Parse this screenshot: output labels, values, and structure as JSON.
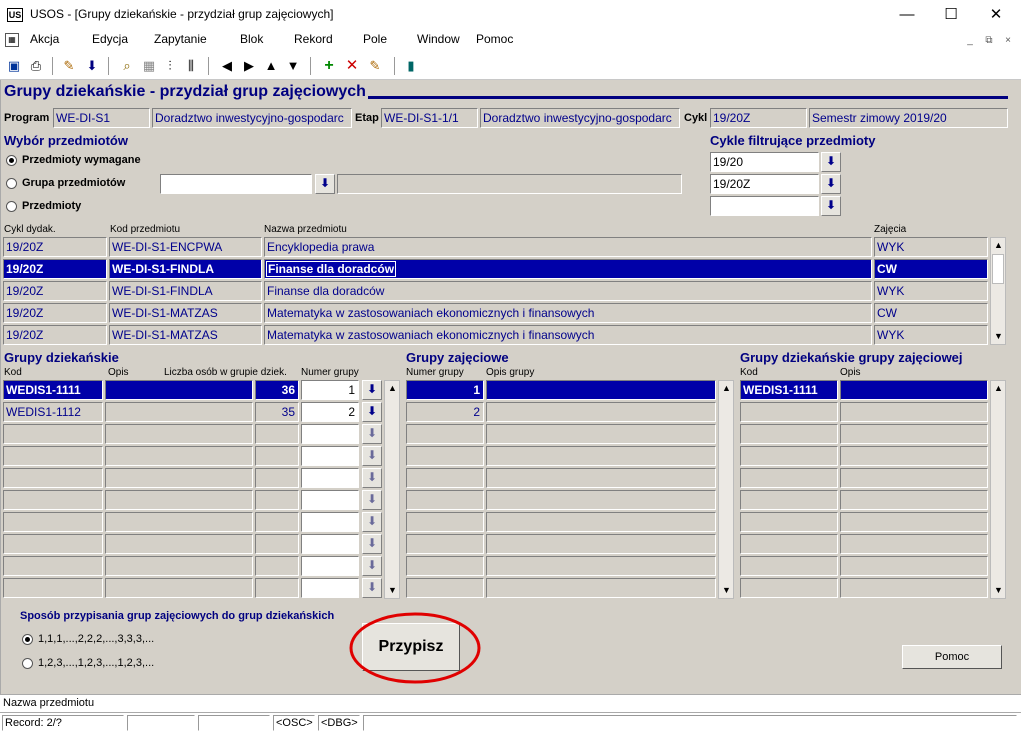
{
  "window": {
    "title": "USOS - [Grupy dziekańskie - przydział grup zajęciowych]",
    "minimize": "—",
    "maximize": "☐",
    "close": "✕"
  },
  "menu": {
    "items": [
      "Akcja",
      "Edycja",
      "Zapytanie",
      "Blok",
      "Rekord",
      "Pole",
      "Window",
      "Pomoc"
    ],
    "mdi_minimize": "_",
    "mdi_restore": "⧉",
    "mdi_close": "×"
  },
  "toolbar": {
    "icons": [
      "save-icon",
      "print-icon",
      "edit-icon",
      "download-icon",
      "query-icon",
      "grid-icon",
      "chart-icon",
      "chart2-icon",
      "first-icon",
      "next-icon",
      "up-icon",
      "down-icon",
      "add-icon",
      "delete-icon",
      "clear-icon",
      "exit-icon"
    ]
  },
  "form": {
    "title": "Grupy dziekańskie - przydział grup zajęciowych",
    "program_label": "Program",
    "program_code": "WE-DI-S1",
    "program_name": "Doradztwo inwestycyjno-gospodarc",
    "etap_label": "Etap",
    "etap_code": "WE-DI-S1-1/1",
    "etap_name": "Doradztwo inwestycyjno-gospodarc",
    "cykl_label": "Cykl",
    "cykl_code": "19/20Z",
    "cykl_name": "Semestr zimowy 2019/20"
  },
  "wybor": {
    "title": "Wybór przedmiotów",
    "options": [
      "Przedmioty wymagane",
      "Grupa przedmiotów",
      "Przedmioty"
    ],
    "selected_index": 0,
    "group_value": "",
    "group_desc": ""
  },
  "cykle": {
    "title": "Cykle filtrujące przedmioty",
    "values": [
      "19/20",
      "19/20Z",
      ""
    ]
  },
  "subjects": {
    "headers": [
      "Cykl dydak.",
      "Kod przedmiotu",
      "Nazwa przedmiotu",
      "Zajęcia"
    ],
    "rows": [
      {
        "cykl": "19/20Z",
        "kod": "WE-DI-S1-ENCPWA",
        "nazwa": "Encyklopedia prawa",
        "zajecia": "WYK"
      },
      {
        "cykl": "19/20Z",
        "kod": "WE-DI-S1-FINDLA",
        "nazwa": "Finanse dla doradców",
        "zajecia": "CW"
      },
      {
        "cykl": "19/20Z",
        "kod": "WE-DI-S1-FINDLA",
        "nazwa": "Finanse dla doradców",
        "zajecia": "WYK"
      },
      {
        "cykl": "19/20Z",
        "kod": "WE-DI-S1-MATZAS",
        "nazwa": "Matematyka w zastosowaniach ekonomicznych i finansowych",
        "zajecia": "CW"
      },
      {
        "cykl": "19/20Z",
        "kod": "WE-DI-S1-MATZAS",
        "nazwa": "Matematyka w zastosowaniach ekonomicznych i finansowych",
        "zajecia": "WYK"
      }
    ],
    "selected_index": 1
  },
  "dziekanskie": {
    "title": "Grupy dziekańskie",
    "headers": [
      "Kod",
      "Opis",
      "Liczba osób w grupie dziek.",
      "Numer grupy"
    ],
    "rows": [
      {
        "kod": "WEDIS1-1111",
        "opis": "",
        "liczba": "36",
        "numer": "1"
      },
      {
        "kod": "WEDIS1-1112",
        "opis": "",
        "liczba": "35",
        "numer": "2"
      }
    ]
  },
  "zajeciowe": {
    "title": "Grupy zajęciowe",
    "headers": [
      "Numer grupy",
      "Opis grupy"
    ],
    "rows": [
      {
        "numer": "1",
        "opis": ""
      },
      {
        "numer": "2",
        "opis": ""
      }
    ]
  },
  "dz_zaj": {
    "title": "Grupy dziekańskie grupy zajęciowej",
    "headers": [
      "Kod",
      "Opis"
    ],
    "rows": [
      {
        "kod": "WEDIS1-1111",
        "opis": ""
      }
    ]
  },
  "sposob": {
    "title": "Sposób przypisania grup zajęciowych do grup dziekańskich",
    "options": [
      "1,1,1,...,2,2,2,...,3,3,3,...",
      "1,2,3,...,1,2,3,...,1,2,3,..."
    ],
    "selected_index": 0
  },
  "buttons": {
    "przypisz": "Przypisz",
    "pomoc": "Pomoc"
  },
  "status": {
    "hint": "Nazwa przedmiotu",
    "record": "Record: 2/?",
    "cells": [
      "",
      "",
      "<OSC>",
      "<DBG>"
    ]
  },
  "colors": {
    "accent": "#000080",
    "selection": "#0000a8",
    "canvas": "#d4d0c8",
    "highlight_circle": "#e00000"
  }
}
